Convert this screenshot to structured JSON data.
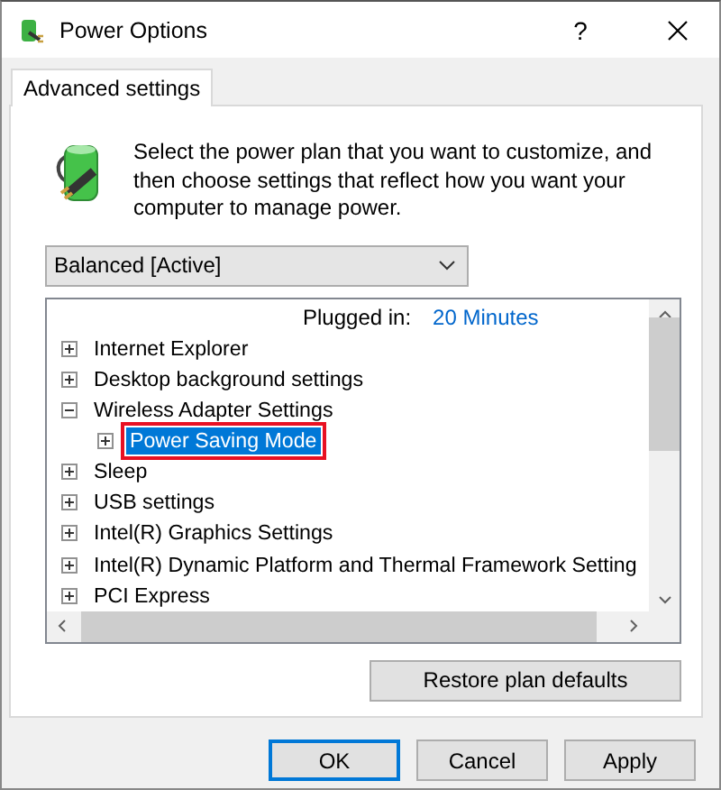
{
  "window": {
    "title": "Power Options",
    "help": "?"
  },
  "tabs": [
    {
      "label": "Advanced settings",
      "selected": true
    }
  ],
  "intro": "Select the power plan that you want to customize, and then choose settings that reflect how you want your computer to manage power.",
  "plan_dropdown": {
    "value": "Balanced [Active]"
  },
  "tree": [
    {
      "kind": "value",
      "label": "Plugged in:",
      "value": "20 Minutes"
    },
    {
      "kind": "group",
      "label": "Internet Explorer",
      "expanded": false,
      "selected": false
    },
    {
      "kind": "group",
      "label": "Desktop background settings",
      "expanded": false,
      "selected": false
    },
    {
      "kind": "group",
      "label": "Wireless Adapter Settings",
      "expanded": true,
      "selected": false,
      "children": [
        {
          "kind": "group",
          "label": "Power Saving Mode",
          "expanded": false,
          "selected": true,
          "outlined": true
        }
      ]
    },
    {
      "kind": "group",
      "label": "Sleep",
      "expanded": false,
      "selected": false
    },
    {
      "kind": "group",
      "label": "USB settings",
      "expanded": false,
      "selected": false
    },
    {
      "kind": "group",
      "label": "Intel(R) Graphics Settings",
      "expanded": false,
      "selected": false
    },
    {
      "kind": "group",
      "label": "Intel(R) Dynamic Platform and Thermal Framework Setting",
      "expanded": false,
      "selected": false
    },
    {
      "kind": "group",
      "label": "PCI Express",
      "expanded": false,
      "selected": false
    }
  ],
  "restore_button": "Restore plan defaults",
  "buttons": [
    {
      "label": "OK",
      "default": true
    },
    {
      "label": "Cancel",
      "default": false
    },
    {
      "label": "Apply",
      "default": false
    }
  ]
}
